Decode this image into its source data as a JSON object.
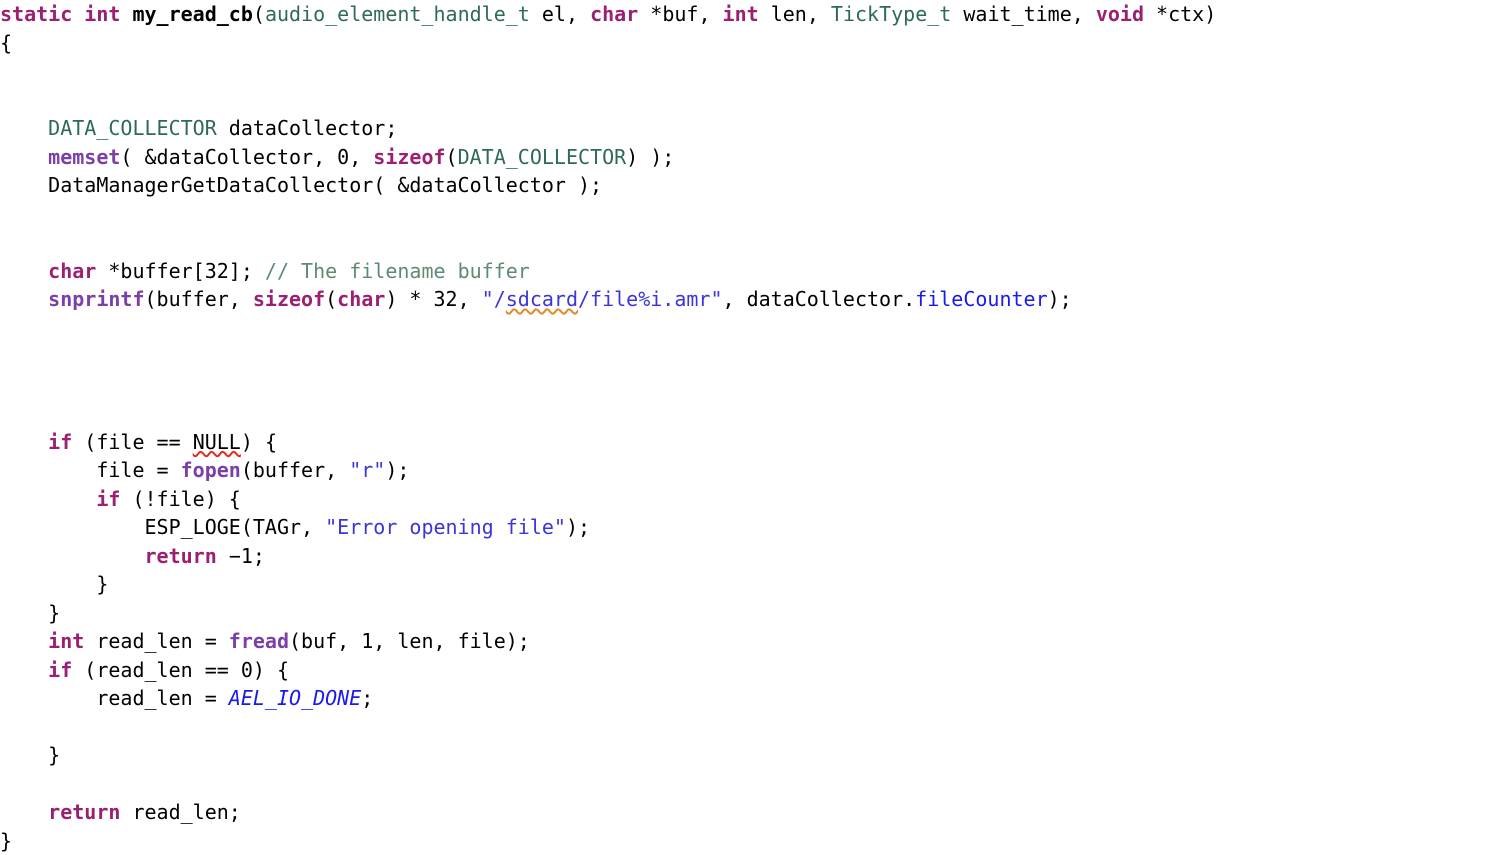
{
  "editor": {
    "language": "c",
    "background_color": "#ffffff",
    "default_text_color": "#000000",
    "theme_colors": {
      "keyword": "#9b2072",
      "type": "#2e6b52",
      "function_name": "#000000",
      "function_call": "#7b3fa8",
      "string": "#3a36d8",
      "comment": "#5f8a72",
      "member": "#1a1aee",
      "macro_constant": "#1a1aee",
      "spellcheck_error": "#e03020",
      "spellcheck_warning": "#e08a2a"
    }
  },
  "code": {
    "lines": [
      {
        "n": 1,
        "text": "static int my_read_cb(audio_element_handle_t el, char *buf, int len, TickType_t wait_time, void *ctx)",
        "tokens": [
          {
            "t": "static",
            "c": "keyword"
          },
          {
            "t": " ",
            "c": "plain"
          },
          {
            "t": "int",
            "c": "keyword"
          },
          {
            "t": " ",
            "c": "plain"
          },
          {
            "t": "my_read_cb",
            "c": "funcname"
          },
          {
            "t": "(",
            "c": "plain"
          },
          {
            "t": "audio_element_handle_t",
            "c": "type"
          },
          {
            "t": " el, ",
            "c": "plain"
          },
          {
            "t": "char",
            "c": "keyword"
          },
          {
            "t": " *buf, ",
            "c": "plain"
          },
          {
            "t": "int",
            "c": "keyword"
          },
          {
            "t": " len, ",
            "c": "plain"
          },
          {
            "t": "TickType_t",
            "c": "type"
          },
          {
            "t": " wait_time, ",
            "c": "plain"
          },
          {
            "t": "void",
            "c": "keyword"
          },
          {
            "t": " *ctx)",
            "c": "plain"
          }
        ]
      },
      {
        "n": 2,
        "text": "{",
        "tokens": [
          {
            "t": "{",
            "c": "plain"
          }
        ]
      },
      {
        "n": 3,
        "text": "",
        "tokens": []
      },
      {
        "n": 4,
        "text": "",
        "tokens": []
      },
      {
        "n": 5,
        "text": "    DATA_COLLECTOR dataCollector;",
        "tokens": [
          {
            "t": "    ",
            "c": "plain"
          },
          {
            "t": "DATA_COLLECTOR",
            "c": "type"
          },
          {
            "t": " dataCollector;",
            "c": "plain"
          }
        ]
      },
      {
        "n": 6,
        "text": "    memset( &dataCollector, 0, sizeof(DATA_COLLECTOR) );",
        "tokens": [
          {
            "t": "    ",
            "c": "plain"
          },
          {
            "t": "memset",
            "c": "call"
          },
          {
            "t": "( &dataCollector, 0, ",
            "c": "plain"
          },
          {
            "t": "sizeof",
            "c": "keyword"
          },
          {
            "t": "(",
            "c": "plain"
          },
          {
            "t": "DATA_COLLECTOR",
            "c": "type"
          },
          {
            "t": ") );",
            "c": "plain"
          }
        ]
      },
      {
        "n": 7,
        "text": "    DataManagerGetDataCollector( &dataCollector );",
        "tokens": [
          {
            "t": "    DataManagerGetDataCollector( &dataCollector );",
            "c": "plain"
          }
        ]
      },
      {
        "n": 8,
        "text": "",
        "tokens": []
      },
      {
        "n": 9,
        "text": "",
        "tokens": []
      },
      {
        "n": 10,
        "text": "    char *buffer[32]; // The filename buffer",
        "tokens": [
          {
            "t": "    ",
            "c": "plain"
          },
          {
            "t": "char",
            "c": "keyword"
          },
          {
            "t": " *buffer[32]; ",
            "c": "plain"
          },
          {
            "t": "// The filename buffer",
            "c": "comment"
          }
        ]
      },
      {
        "n": 11,
        "text": "    snprintf(buffer, sizeof(char) * 32, \"/sdcard/file%i.amr\", dataCollector.fileCounter);",
        "tokens": [
          {
            "t": "    ",
            "c": "plain"
          },
          {
            "t": "snprintf",
            "c": "call"
          },
          {
            "t": "(buffer, ",
            "c": "plain"
          },
          {
            "t": "sizeof",
            "c": "keyword"
          },
          {
            "t": "(",
            "c": "plain"
          },
          {
            "t": "char",
            "c": "keyword"
          },
          {
            "t": ") * 32, ",
            "c": "plain"
          },
          {
            "t": "\"/",
            "c": "string"
          },
          {
            "t": "sdcard",
            "c": "string",
            "spell": "orange"
          },
          {
            "t": "/file%i.amr\"",
            "c": "string"
          },
          {
            "t": ", dataCollector.",
            "c": "plain"
          },
          {
            "t": "fileCounter",
            "c": "member"
          },
          {
            "t": ");",
            "c": "plain"
          }
        ]
      },
      {
        "n": 12,
        "text": "",
        "tokens": []
      },
      {
        "n": 13,
        "text": "",
        "tokens": []
      },
      {
        "n": 14,
        "text": "",
        "tokens": []
      },
      {
        "n": 15,
        "text": "",
        "tokens": []
      },
      {
        "n": 16,
        "text": "    if (file == NULL) {",
        "tokens": [
          {
            "t": "    ",
            "c": "plain"
          },
          {
            "t": "if",
            "c": "keyword"
          },
          {
            "t": " (file == ",
            "c": "plain"
          },
          {
            "t": "NULL",
            "c": "plain",
            "spell": "red"
          },
          {
            "t": ") {",
            "c": "plain"
          }
        ]
      },
      {
        "n": 17,
        "text": "        file = fopen(buffer, \"r\");",
        "tokens": [
          {
            "t": "        file = ",
            "c": "plain"
          },
          {
            "t": "fopen",
            "c": "call"
          },
          {
            "t": "(buffer, ",
            "c": "plain"
          },
          {
            "t": "\"r\"",
            "c": "string"
          },
          {
            "t": ");",
            "c": "plain"
          }
        ]
      },
      {
        "n": 18,
        "text": "        if (!file) {",
        "tokens": [
          {
            "t": "        ",
            "c": "plain"
          },
          {
            "t": "if",
            "c": "keyword"
          },
          {
            "t": " (!file) {",
            "c": "plain"
          }
        ]
      },
      {
        "n": 19,
        "text": "            ESP_LOGE(TAGr, \"Error opening file\");",
        "tokens": [
          {
            "t": "            ESP_LOGE(TAGr, ",
            "c": "plain"
          },
          {
            "t": "\"Error opening file\"",
            "c": "string"
          },
          {
            "t": ");",
            "c": "plain"
          }
        ]
      },
      {
        "n": 20,
        "text": "            return -1;",
        "tokens": [
          {
            "t": "            ",
            "c": "plain"
          },
          {
            "t": "return",
            "c": "keyword"
          },
          {
            "t": " −1;",
            "c": "plain"
          }
        ]
      },
      {
        "n": 21,
        "text": "        }",
        "tokens": [
          {
            "t": "        }",
            "c": "plain"
          }
        ]
      },
      {
        "n": 22,
        "text": "    }",
        "tokens": [
          {
            "t": "    }",
            "c": "plain"
          }
        ]
      },
      {
        "n": 23,
        "text": "    int read_len = fread(buf, 1, len, file);",
        "tokens": [
          {
            "t": "    ",
            "c": "plain"
          },
          {
            "t": "int",
            "c": "keyword"
          },
          {
            "t": " read_len = ",
            "c": "plain"
          },
          {
            "t": "fread",
            "c": "call"
          },
          {
            "t": "(buf, 1, len, file);",
            "c": "plain"
          }
        ]
      },
      {
        "n": 24,
        "text": "    if (read_len == 0) {",
        "tokens": [
          {
            "t": "    ",
            "c": "plain"
          },
          {
            "t": "if",
            "c": "keyword"
          },
          {
            "t": " (read_len == 0) {",
            "c": "plain"
          }
        ]
      },
      {
        "n": 25,
        "text": "        read_len = AEL_IO_DONE;",
        "tokens": [
          {
            "t": "        read_len = ",
            "c": "plain"
          },
          {
            "t": "AEL_IO_DONE",
            "c": "macro"
          },
          {
            "t": ";",
            "c": "plain"
          }
        ]
      },
      {
        "n": 26,
        "text": "",
        "tokens": []
      },
      {
        "n": 27,
        "text": "    }",
        "tokens": [
          {
            "t": "    }",
            "c": "plain"
          }
        ]
      },
      {
        "n": 28,
        "text": "",
        "tokens": []
      },
      {
        "n": 29,
        "text": "    return read_len;",
        "tokens": [
          {
            "t": "    ",
            "c": "plain"
          },
          {
            "t": "return",
            "c": "keyword"
          },
          {
            "t": " read_len;",
            "c": "plain"
          }
        ]
      },
      {
        "n": 30,
        "text": "}",
        "tokens": [
          {
            "t": "}",
            "c": "plain"
          }
        ]
      }
    ]
  }
}
